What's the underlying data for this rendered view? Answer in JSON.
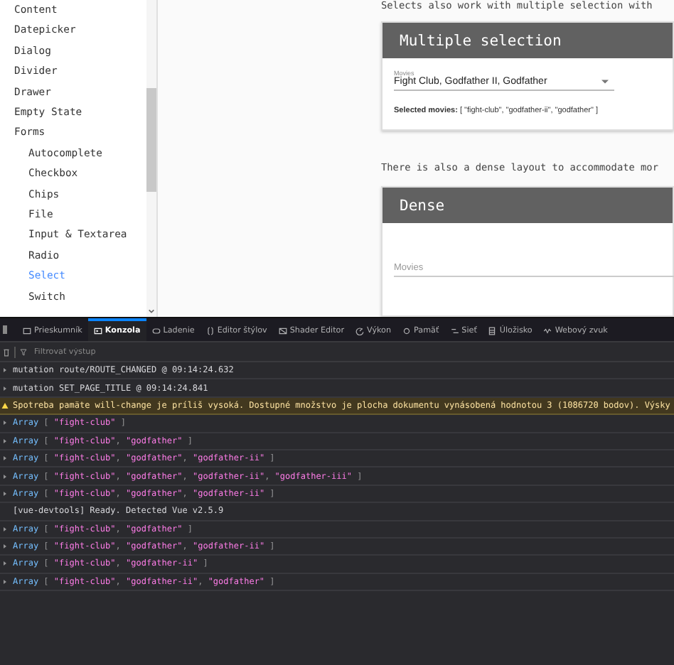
{
  "sidebar": {
    "items": [
      {
        "label": "Content",
        "selected": false
      },
      {
        "label": "Datepicker",
        "selected": false
      },
      {
        "label": "Dialog",
        "selected": false
      },
      {
        "label": "Divider",
        "selected": false
      },
      {
        "label": "Drawer",
        "selected": false
      },
      {
        "label": "Empty State",
        "selected": false
      },
      {
        "label": "Forms",
        "selected": false,
        "children": [
          {
            "label": "Autocomplete",
            "selected": false
          },
          {
            "label": "Checkbox",
            "selected": false
          },
          {
            "label": "Chips",
            "selected": false
          },
          {
            "label": "File",
            "selected": false
          },
          {
            "label": "Input & Textarea",
            "selected": false
          },
          {
            "label": "Radio",
            "selected": false
          },
          {
            "label": "Select",
            "selected": true
          },
          {
            "label": "Switch",
            "selected": false
          }
        ]
      }
    ]
  },
  "content": {
    "intro": "Selects also work with multiple selection with",
    "multiple_card": {
      "title": "Multiple selection",
      "field": {
        "label": "Movies",
        "value": "Fight Club, Godfather II, Godfather"
      },
      "result": "**Selected movies:** [ \"fight-club\", \"godfather-ii\", \"godfather\" ]"
    },
    "dense_intro": "There is also a dense layout to accommodate mor",
    "dense_card": {
      "title": "Dense",
      "field": {
        "placeholder": "Movies"
      }
    }
  },
  "devtools": {
    "tabs": [
      {
        "label": "Prieskumník",
        "selected": false
      },
      {
        "label": "Konzola",
        "selected": true
      },
      {
        "label": "Ladenie",
        "selected": false
      },
      {
        "label": "Editor štýlov",
        "selected": false
      },
      {
        "label": "Shader Editor",
        "selected": false
      },
      {
        "label": "Výkon",
        "selected": false
      },
      {
        "label": "Pamäť",
        "selected": false
      },
      {
        "label": "Sieť",
        "selected": false
      },
      {
        "label": "Úložisko",
        "selected": false
      },
      {
        "label": "Webový zvuk",
        "selected": false
      }
    ],
    "filter": {
      "placeholder": "Filtrovať výstup"
    },
    "messages": [
      {
        "kind": "group",
        "parts": [
          {
            "t": "mutation route/ROUTE_CHANGED @ 09:14:24.632",
            "kind": "text"
          }
        ]
      },
      {
        "kind": "group",
        "parts": [
          {
            "t": "mutation SET_PAGE_TITLE @ 09:14:24.841",
            "kind": "text"
          }
        ]
      },
      {
        "kind": "warning",
        "parts": [
          {
            "t": "Spotreba pamäte will-change je príliš vysoká. Dostupné množstvo je plocha dokumentu vynásobená hodnotou 3 (1086720 bodov). Výsky",
            "kind": "text"
          }
        ]
      },
      {
        "kind": "group",
        "parts": [
          {
            "t": "Array",
            "kind": "type"
          },
          {
            "t": " [ ",
            "kind": "punct"
          },
          {
            "t": "\"fight-club\"",
            "kind": "string"
          },
          {
            "t": " ]",
            "kind": "punct"
          }
        ]
      },
      {
        "kind": "group",
        "parts": [
          {
            "t": "Array",
            "kind": "type"
          },
          {
            "t": " [ ",
            "kind": "punct"
          },
          {
            "t": "\"fight-club\"",
            "kind": "string"
          },
          {
            "t": ", ",
            "kind": "punct"
          },
          {
            "t": "\"godfather\"",
            "kind": "string"
          },
          {
            "t": " ]",
            "kind": "punct"
          }
        ]
      },
      {
        "kind": "group",
        "parts": [
          {
            "t": "Array",
            "kind": "type"
          },
          {
            "t": " [ ",
            "kind": "punct"
          },
          {
            "t": "\"fight-club\"",
            "kind": "string"
          },
          {
            "t": ", ",
            "kind": "punct"
          },
          {
            "t": "\"godfather\"",
            "kind": "string"
          },
          {
            "t": ", ",
            "kind": "punct"
          },
          {
            "t": "\"godfather-ii\"",
            "kind": "string"
          },
          {
            "t": " ]",
            "kind": "punct"
          }
        ]
      },
      {
        "kind": "group",
        "parts": [
          {
            "t": "Array",
            "kind": "type"
          },
          {
            "t": " [ ",
            "kind": "punct"
          },
          {
            "t": "\"fight-club\"",
            "kind": "string"
          },
          {
            "t": ", ",
            "kind": "punct"
          },
          {
            "t": "\"godfather\"",
            "kind": "string"
          },
          {
            "t": ", ",
            "kind": "punct"
          },
          {
            "t": "\"godfather-ii\"",
            "kind": "string"
          },
          {
            "t": ", ",
            "kind": "punct"
          },
          {
            "t": "\"godfather-iii\"",
            "kind": "string"
          },
          {
            "t": " ]",
            "kind": "punct"
          }
        ]
      },
      {
        "kind": "group",
        "parts": [
          {
            "t": "Array",
            "kind": "type"
          },
          {
            "t": " [ ",
            "kind": "punct"
          },
          {
            "t": "\"fight-club\"",
            "kind": "string"
          },
          {
            "t": ", ",
            "kind": "punct"
          },
          {
            "t": "\"godfather\"",
            "kind": "string"
          },
          {
            "t": ", ",
            "kind": "punct"
          },
          {
            "t": "\"godfather-ii\"",
            "kind": "string"
          },
          {
            "t": " ]",
            "kind": "punct"
          }
        ]
      },
      {
        "kind": "log",
        "parts": [
          {
            "t": "[vue-devtools] Ready. Detected Vue v2.5.9",
            "kind": "text"
          }
        ]
      },
      {
        "kind": "group",
        "parts": [
          {
            "t": "Array",
            "kind": "type"
          },
          {
            "t": " [ ",
            "kind": "punct"
          },
          {
            "t": "\"fight-club\"",
            "kind": "string"
          },
          {
            "t": ", ",
            "kind": "punct"
          },
          {
            "t": "\"godfather\"",
            "kind": "string"
          },
          {
            "t": " ]",
            "kind": "punct"
          }
        ]
      },
      {
        "kind": "group",
        "parts": [
          {
            "t": "Array",
            "kind": "type"
          },
          {
            "t": " [ ",
            "kind": "punct"
          },
          {
            "t": "\"fight-club\"",
            "kind": "string"
          },
          {
            "t": ", ",
            "kind": "punct"
          },
          {
            "t": "\"godfather\"",
            "kind": "string"
          },
          {
            "t": ", ",
            "kind": "punct"
          },
          {
            "t": "\"godfather-ii\"",
            "kind": "string"
          },
          {
            "t": " ]",
            "kind": "punct"
          }
        ]
      },
      {
        "kind": "group",
        "parts": [
          {
            "t": "Array",
            "kind": "type"
          },
          {
            "t": " [ ",
            "kind": "punct"
          },
          {
            "t": "\"fight-club\"",
            "kind": "string"
          },
          {
            "t": ", ",
            "kind": "punct"
          },
          {
            "t": "\"godfather-ii\"",
            "kind": "string"
          },
          {
            "t": " ]",
            "kind": "punct"
          }
        ]
      },
      {
        "kind": "group",
        "parts": [
          {
            "t": "Array",
            "kind": "type"
          },
          {
            "t": " [ ",
            "kind": "punct"
          },
          {
            "t": "\"fight-club\"",
            "kind": "string"
          },
          {
            "t": ", ",
            "kind": "punct"
          },
          {
            "t": "\"godfather-ii\"",
            "kind": "string"
          },
          {
            "t": ", ",
            "kind": "punct"
          },
          {
            "t": "\"godfather\"",
            "kind": "string"
          },
          {
            "t": " ]",
            "kind": "punct"
          }
        ]
      }
    ]
  }
}
